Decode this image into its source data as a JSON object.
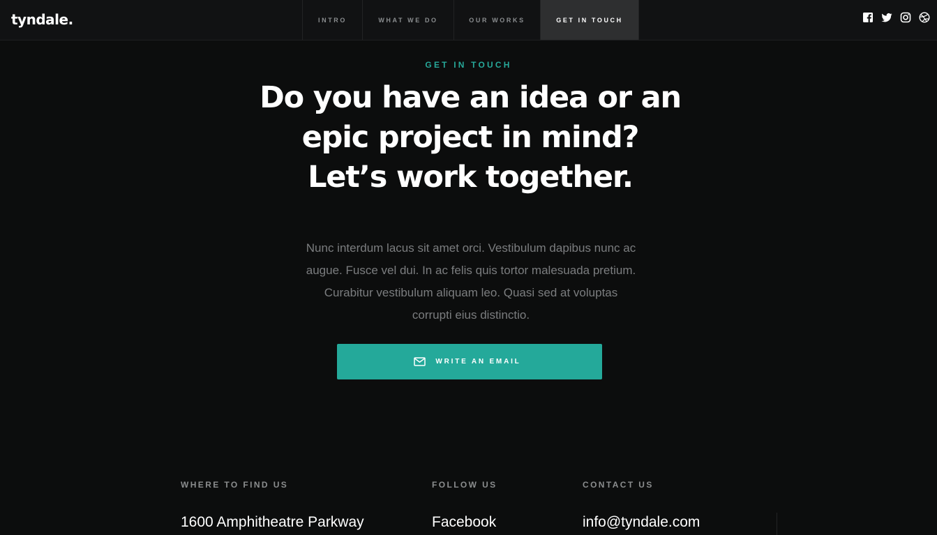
{
  "header": {
    "logo": "tyndale.",
    "nav": [
      {
        "label": "INTRO"
      },
      {
        "label": "WHAT WE DO"
      },
      {
        "label": "OUR WORKS"
      },
      {
        "label": "GET IN TOUCH",
        "active": true
      }
    ],
    "social_icons": [
      "facebook-icon",
      "twitter-icon",
      "instagram-icon",
      "dribbble-icon"
    ]
  },
  "contact": {
    "eyebrow": "GET IN TOUCH",
    "headline": "Do you have an idea or an epic project in mind? Let’s work together.",
    "description": "Nunc interdum lacus sit amet orci. Vestibulum dapibus nunc ac augue. Fusce vel dui. In ac felis quis tortor malesuada pretium. Curabitur vestibulum aliquam leo. Quasi sed at voluptas corrupti eius distinctio.",
    "cta_label": "WRITE AN EMAIL",
    "cta_icon": "mail-icon"
  },
  "info": {
    "where": {
      "title": "WHERE TO FIND US",
      "value": "1600 Amphitheatre Parkway"
    },
    "follow": {
      "title": "FOLLOW US",
      "value": "Facebook"
    },
    "contact": {
      "title": "CONTACT US",
      "value": "info@tyndale.com"
    }
  },
  "colors": {
    "accent": "#24a99a",
    "background": "#0c0d0d",
    "header": "#111213"
  }
}
